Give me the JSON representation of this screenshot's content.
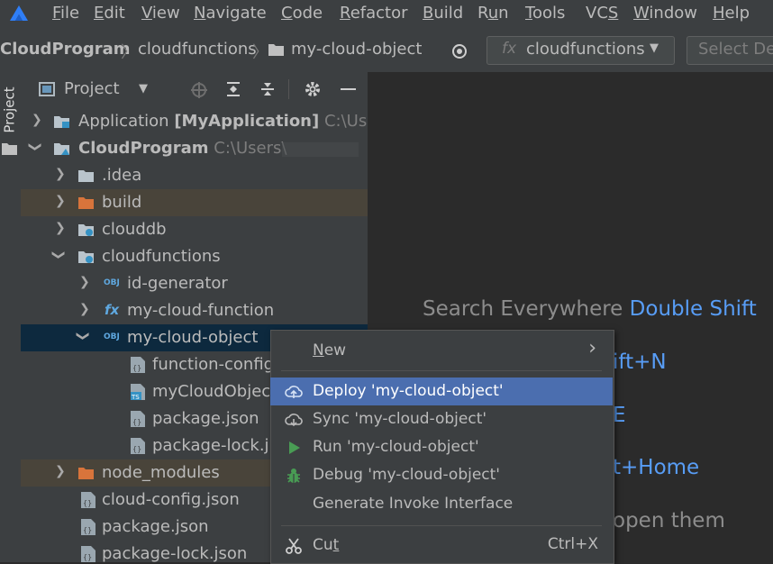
{
  "menubar": {
    "items": [
      {
        "mn": "F",
        "rest": "ile"
      },
      {
        "mn": "E",
        "rest": "dit"
      },
      {
        "mn": "V",
        "rest": "iew"
      },
      {
        "mn": "N",
        "rest": "avigate"
      },
      {
        "mn": "C",
        "rest": "ode"
      },
      {
        "mn": "R",
        "rest": "efactor"
      },
      {
        "mn": "B",
        "rest": "uild"
      },
      {
        "pre": "R",
        "mn": "u",
        "rest": "n"
      },
      {
        "mn": "T",
        "rest": "ools"
      },
      {
        "pre": "VC",
        "mn": "S",
        "rest": ""
      },
      {
        "mn": "W",
        "rest": "indow"
      },
      {
        "mn": "H",
        "rest": "elp"
      }
    ]
  },
  "navbar": {
    "crumb_root": "CloudProgram",
    "crumb_mid": "cloudfunctions",
    "crumb_leaf": "my-cloud-object",
    "function_combo": "cloudfunctions",
    "fx_label": "fx",
    "device_combo": "Select De"
  },
  "leftstrip": {
    "tab": "Project"
  },
  "panel": {
    "title": "Project"
  },
  "tree": [
    {
      "label": "Application",
      "bold": "[MyApplication]",
      "path": "C:\\Use"
    },
    {
      "label": "CloudProgram",
      "path": "C:\\Users\\"
    },
    {
      "label": ".idea"
    },
    {
      "label": "build"
    },
    {
      "label": "clouddb"
    },
    {
      "label": "cloudfunctions"
    },
    {
      "label": "id-generator",
      "badge": "OBJ"
    },
    {
      "label": "my-cloud-function",
      "badge": "fx"
    },
    {
      "label": "my-cloud-object",
      "badge": "OBJ"
    },
    {
      "label": "function-config"
    },
    {
      "label": "myCloudObjec"
    },
    {
      "label": "package.json"
    },
    {
      "label": "package-lock.j"
    },
    {
      "label": "node_modules"
    },
    {
      "label": "cloud-config.json"
    },
    {
      "label": "package.json"
    },
    {
      "label": "package-lock.json"
    }
  ],
  "editor_hints": {
    "search_label": "Search Everywhere",
    "search_key": "Double Shift",
    "h2": "ift+N",
    "h3": "E",
    "h4": "t+Home",
    "h5": "open them"
  },
  "context_menu": {
    "new_mn": "N",
    "new_rest": "ew",
    "deploy": "Deploy 'my-cloud-object'",
    "sync": "Sync 'my-cloud-object'",
    "run": "Run 'my-cloud-object'",
    "debug": "Debug 'my-cloud-object'",
    "generate": "Generate Invoke Interface",
    "cut_pre": "Cu",
    "cut_mn": "t",
    "cut_short": "Ctrl+X",
    "submenu_arrow": "›"
  },
  "colors": {
    "accent": "#589df6",
    "menu_highlight": "#4b6eaf",
    "selection": "#0d293e",
    "excluded": "#49443a",
    "folder_orange": "#d8743b",
    "run_green": "#499c54"
  }
}
